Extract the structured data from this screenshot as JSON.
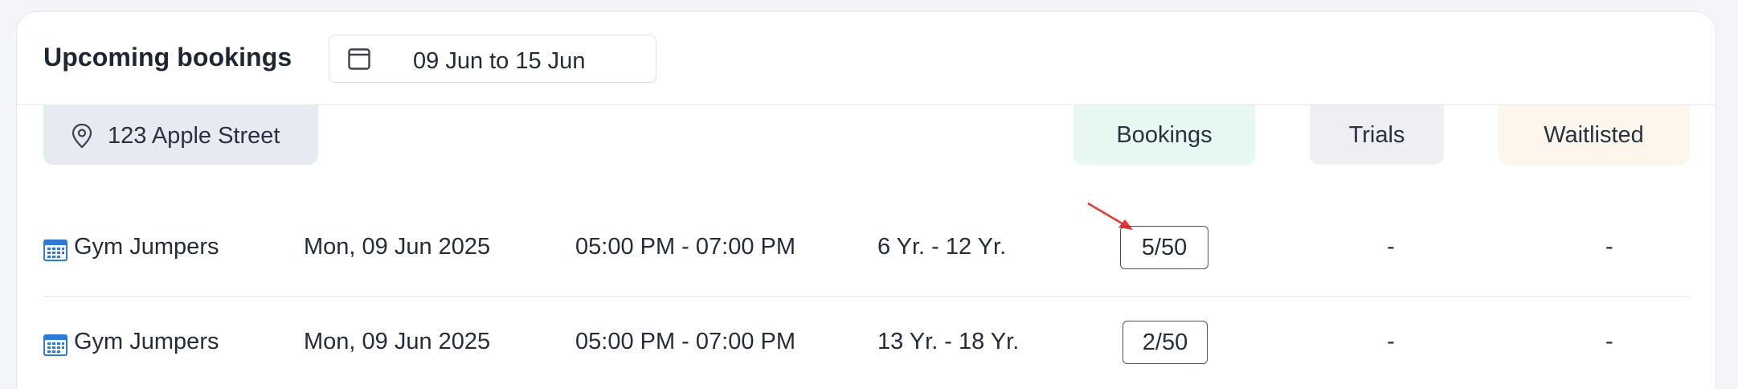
{
  "header": {
    "title": "Upcoming bookings",
    "date_range": "09 Jun to 15 Jun"
  },
  "location": {
    "label": "123 Apple Street"
  },
  "columns": {
    "bookings": "Bookings",
    "trials": "Trials",
    "waitlisted": "Waitlisted"
  },
  "rows": [
    {
      "name": "Gym Jumpers",
      "date": "Mon, 09 Jun 2025",
      "time": "05:00 PM - 07:00 PM",
      "age": "6 Yr. - 12 Yr.",
      "bookings": "5/50",
      "trials": "-",
      "waitlisted": "-"
    },
    {
      "name": "Gym Jumpers",
      "date": "Mon, 09 Jun 2025",
      "time": "05:00 PM - 07:00 PM",
      "age": "13 Yr. - 18 Yr.",
      "bookings": "2/50",
      "trials": "-",
      "waitlisted": "-"
    }
  ],
  "icons": {
    "date_picker": "calendar-icon",
    "location": "map-pin-icon",
    "row": "schedule-calendar-icon",
    "annotation": "red-arrow-icon"
  },
  "colors": {
    "bookings_header_bg": "#e7f7f1",
    "trials_header_bg": "#eeeef3",
    "waitlisted_header_bg": "#fdf6ec",
    "location_chip_bg": "#e6eaf1",
    "annotation_arrow": "#e53935",
    "row_icon": "#2e7bd6"
  }
}
